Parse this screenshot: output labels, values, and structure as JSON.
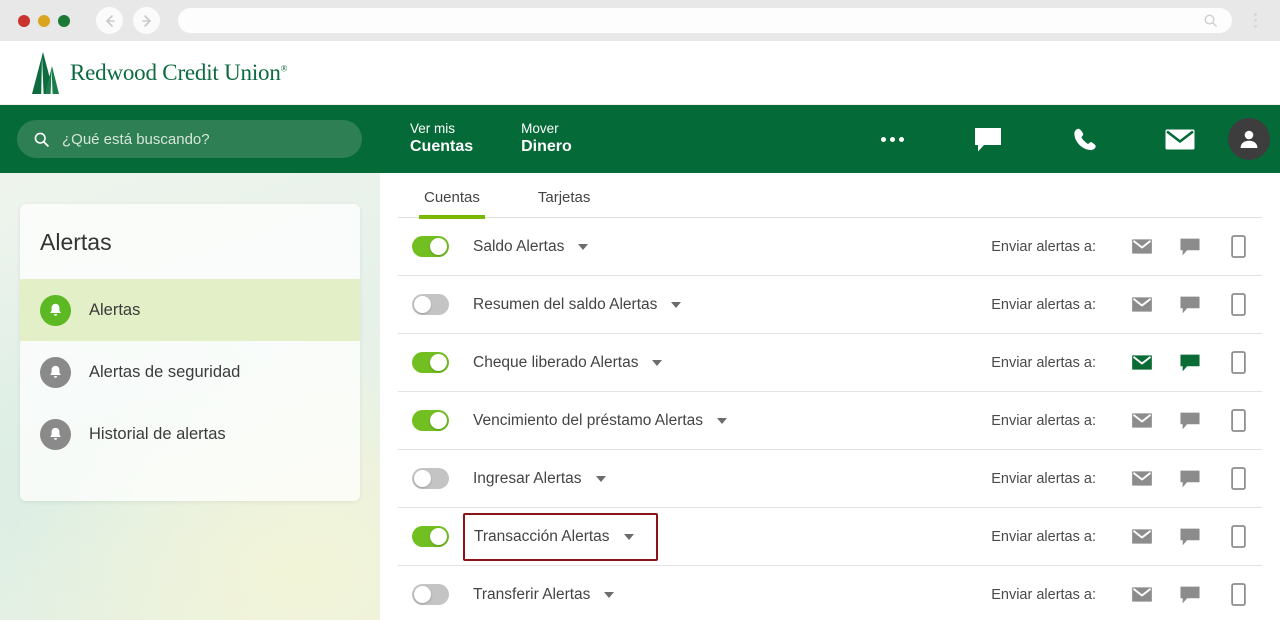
{
  "browser": {
    "traffic_lights": [
      "red",
      "yellow",
      "green"
    ],
    "back_icon": "back-arrow-icon",
    "forward_icon": "forward-arrow-icon",
    "url_value": "",
    "url_search_icon": "search-icon",
    "menu_icon": "kebab-menu-icon"
  },
  "brand": {
    "name": "Redwood Credit Union",
    "trademark": "®",
    "logo_icon": "redwood-trees-logo",
    "color": "#0d6b3f"
  },
  "navbar": {
    "background": "#046a38",
    "search": {
      "icon": "search-icon",
      "placeholder": "¿Qué está buscando?",
      "value": ""
    },
    "links": [
      {
        "line1": "Ver mis",
        "line2": "Cuentas"
      },
      {
        "line1": "Mover",
        "line2": "Dinero"
      }
    ],
    "icons": [
      {
        "name": "more-ellipsis-icon",
        "label": "Más"
      },
      {
        "name": "chat-icon",
        "label": "Chat"
      },
      {
        "name": "phone-icon",
        "label": "Teléfono"
      },
      {
        "name": "mail-icon",
        "label": "Correo"
      }
    ],
    "avatar": {
      "name": "avatar",
      "icon": "person-icon",
      "background": "#3d3d3d"
    }
  },
  "sidebar": {
    "title": "Alertas",
    "items": [
      {
        "label": "Alertas",
        "icon": "bell-icon",
        "active": true
      },
      {
        "label": "Alertas de seguridad",
        "icon": "bell-icon",
        "active": false
      },
      {
        "label": "Historial de alertas",
        "icon": "bell-icon",
        "active": false
      }
    ],
    "active_background": "#e3efc6",
    "active_icon_color": "#5cb924",
    "inactive_icon_color": "#8a8a8a"
  },
  "main": {
    "tabs": [
      {
        "label": "Cuentas",
        "active": true
      },
      {
        "label": "Tarjetas",
        "active": false
      }
    ],
    "tab_accent": "#7ab800",
    "send_to_label": "Enviar alertas a:",
    "channel_icons": [
      "mail-icon",
      "chat-icon",
      "mobile-icon"
    ],
    "channel_on_color": "#0b6b35",
    "channel_off_color": "#8c8c8c",
    "highlight_color": "#8b1516",
    "rows": [
      {
        "label": "Saldo Alertas",
        "enabled": true,
        "highlighted": false,
        "channels": {
          "mail": false,
          "chat": false,
          "mobile": false
        }
      },
      {
        "label": "Resumen del saldo Alertas",
        "enabled": false,
        "highlighted": false,
        "channels": {
          "mail": false,
          "chat": false,
          "mobile": false
        }
      },
      {
        "label": "Cheque liberado Alertas",
        "enabled": true,
        "highlighted": false,
        "channels": {
          "mail": true,
          "chat": true,
          "mobile": false
        }
      },
      {
        "label": "Vencimiento del préstamo Alertas",
        "enabled": true,
        "highlighted": false,
        "channels": {
          "mail": false,
          "chat": false,
          "mobile": false
        }
      },
      {
        "label": "Ingresar Alertas",
        "enabled": false,
        "highlighted": false,
        "channels": {
          "mail": false,
          "chat": false,
          "mobile": false
        }
      },
      {
        "label": "Transacción Alertas",
        "enabled": true,
        "highlighted": true,
        "channels": {
          "mail": false,
          "chat": false,
          "mobile": false
        }
      },
      {
        "label": "Transferir Alertas",
        "enabled": false,
        "highlighted": false,
        "channels": {
          "mail": false,
          "chat": false,
          "mobile": false
        }
      }
    ]
  }
}
